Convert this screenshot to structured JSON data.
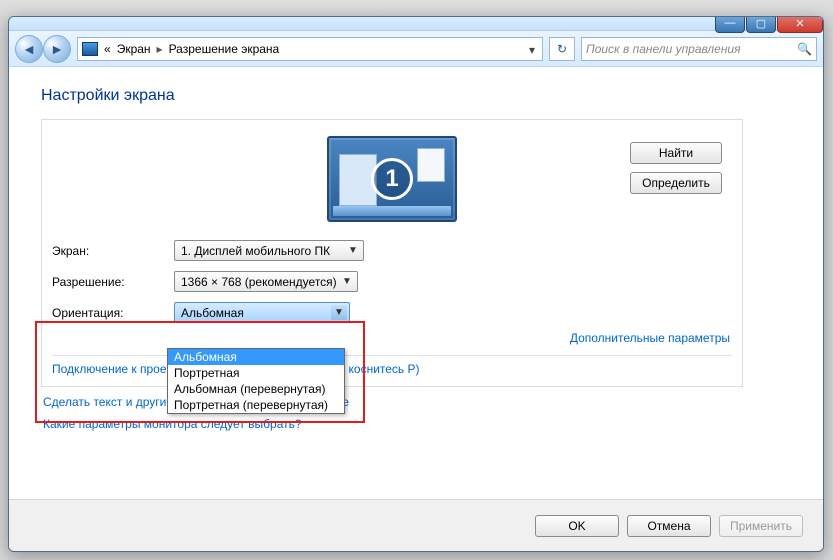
{
  "breadcrumb": {
    "seg1": "Экран",
    "seg2": "Разрешение экрана",
    "prefix": "«"
  },
  "search": {
    "placeholder": "Поиск в панели управления"
  },
  "heading": "Настройки экрана",
  "monitor_number": "1",
  "buttons": {
    "find": "Найти",
    "identify": "Определить",
    "ok": "OK",
    "cancel": "Отмена",
    "apply": "Применить"
  },
  "labels": {
    "display": "Экран:",
    "resolution": "Разрешение:",
    "orientation": "Ориентация:"
  },
  "selects": {
    "display_value": "1. Дисплей мобильного ПК",
    "resolution_value": "1366 × 768 (рекомендуется)",
    "orientation_value": "Альбомная"
  },
  "orientation_options": [
    "Альбомная",
    "Портретная",
    "Альбомная (перевернутая)",
    "Портретная (перевернутая)"
  ],
  "adv_link": "Дополнительные параметры",
  "projector_text": "Подключение к проектору (или нажмите клавишу Windows и коснитесь P)",
  "projector_prefix": "Подключение к проек",
  "projector_suffix": "и коснитесь P)",
  "link_text_size": "Сделать текст и другие элементы больше или меньше",
  "link_which_params": "Какие параметры монитора следует выбрать?"
}
